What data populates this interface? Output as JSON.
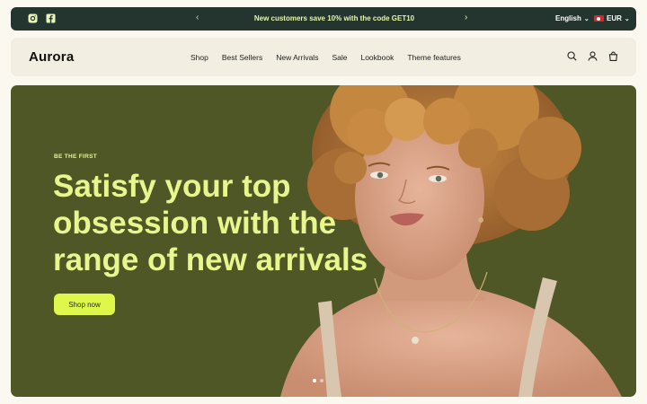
{
  "announcement": {
    "message": "New customers save 10% with the code GET10",
    "prev_icon": "chevron-left-icon",
    "next_icon": "chevron-right-icon",
    "language": "English",
    "currency": "EUR",
    "social_icons": [
      "instagram-icon",
      "facebook-icon"
    ]
  },
  "header": {
    "logo": "Aurora",
    "nav": [
      "Shop",
      "Best Sellers",
      "New Arrivals",
      "Sale",
      "Lookbook",
      "Theme features"
    ],
    "icons": [
      "search-icon",
      "account-icon",
      "cart-icon"
    ]
  },
  "hero": {
    "eyebrow": "BE THE FIRST",
    "headline_lines": [
      "Satisfy your top",
      "obsession with the",
      "range of new arrivals"
    ],
    "cta": "Shop now",
    "slide_count": 2,
    "active_slide": 1
  },
  "colors": {
    "announcement_bg": "#243530",
    "header_bg": "#f2eee2",
    "hero_bg": "#4f5726",
    "accent": "#dff74a",
    "headline": "#e8f68e"
  }
}
